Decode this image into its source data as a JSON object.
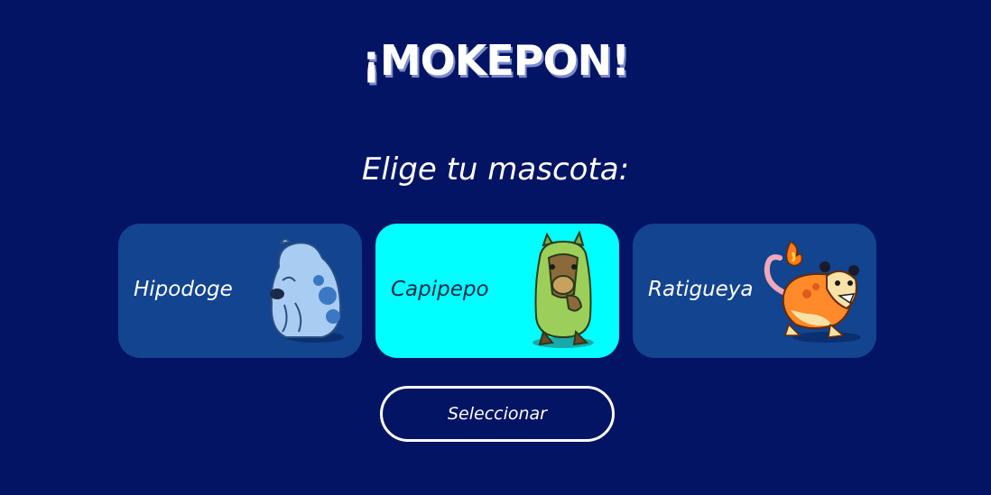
{
  "header": {
    "title": "¡MOKEPON!"
  },
  "subtitle": "Elige tu mascota:",
  "pets": [
    {
      "name": "Hipodoge",
      "icon": "hipodoge-icon",
      "selected": false
    },
    {
      "name": "Capipepo",
      "icon": "capipepo-icon",
      "selected": true
    },
    {
      "name": "Ratigueya",
      "icon": "ratigueya-icon",
      "selected": false
    }
  ],
  "select_button": {
    "label": "Seleccionar"
  },
  "colors": {
    "background": "#021463",
    "card": "#124490",
    "card_selected": "#00ffff",
    "text": "#ffffff"
  }
}
